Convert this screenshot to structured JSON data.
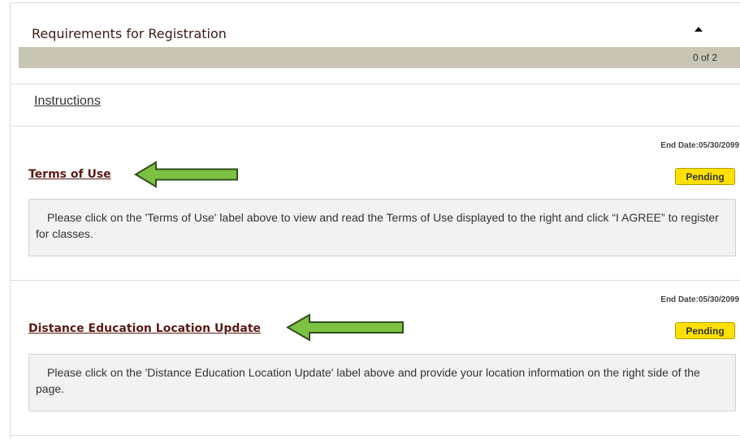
{
  "header": {
    "title": "Requirements for Registration",
    "progress_text": "0 of 2",
    "progress_fraction": 0.0,
    "collapse_icon": "caret-up-icon"
  },
  "instructions": {
    "label": "Instructions"
  },
  "requirements": [
    {
      "label": "Terms of Use",
      "end_date": "End Date:05/30/2099",
      "status": "Pending",
      "description": "Please click on the 'Terms of Use' label above to view and read the Terms of Use displayed to the right and click “I AGREE” to register for classes."
    },
    {
      "label": "Distance Education Location Update",
      "end_date": "End Date:05/30/2099",
      "status": "Pending",
      "description": "Please click on the 'Distance Education Location Update' label above and provide your location information on the right side of the page."
    }
  ],
  "annotations": {
    "arrow_icon": "green-left-arrow-icon",
    "arrow_color": "#7cc142"
  },
  "colors": {
    "link": "#5c1a15",
    "badge": "#ffe000",
    "progress_track": "#e8e5dd"
  }
}
